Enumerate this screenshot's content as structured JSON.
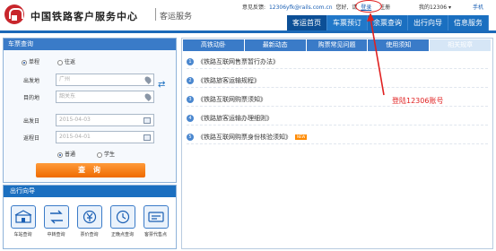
{
  "header": {
    "site_name": "中国铁路客户服务中心",
    "site_sub": "客运服务",
    "feedback_label": "意见反馈:",
    "feedback_email": "12306yfk@rails.com.cn",
    "greeting": "您好,",
    "login_prompt": "请",
    "login_link": "登录",
    "register_link": "注册",
    "my_account": "我的12306 ▾",
    "mobile_link": "手机"
  },
  "mainnav": [
    "客运首页",
    "车票预订",
    "余票查询",
    "出行向导",
    "信息服务"
  ],
  "search": {
    "title": "车票查询",
    "trip_one_way": "单程",
    "trip_round": "往返",
    "from_label": "出发地",
    "from_value": "广州",
    "to_label": "目的地",
    "to_value": "韶关东",
    "depart_label": "出发日",
    "depart_value": "2015-04-03",
    "return_label": "返程日",
    "return_value": "2015-04-01",
    "type_normal": "普通",
    "type_student": "学生",
    "query_button": "查 询"
  },
  "guide": {
    "title": "出行向导",
    "items": [
      {
        "label": "车站查询",
        "icon": "station-icon"
      },
      {
        "label": "中转查询",
        "icon": "transfer-icon"
      },
      {
        "label": "票价查询",
        "icon": "price-icon"
      },
      {
        "label": "正晚点查询",
        "icon": "clock-icon"
      },
      {
        "label": "客票代售点",
        "icon": "agency-icon"
      }
    ]
  },
  "tabs": [
    "高铁动卧",
    "最新动态",
    "购票常见问题",
    "使用须知",
    "相关规章"
  ],
  "notices": [
    {
      "num": "1",
      "text": "《铁路互联网售票暂行办法》",
      "new": ""
    },
    {
      "num": "2",
      "text": "《铁路旅客运输规程》",
      "new": ""
    },
    {
      "num": "3",
      "text": "《铁路互联网购票须知》",
      "new": ""
    },
    {
      "num": "4",
      "text": "《铁路旅客运输办理细则》",
      "new": ""
    },
    {
      "num": "5",
      "text": "《铁路互联网购票身份核验须知》",
      "new": "NEW"
    }
  ],
  "annotation": {
    "text": "登陆12306账号",
    "color": "#e02020"
  },
  "colors": {
    "brand_red": "#c8262c",
    "nav_blue": "#1a6fc0",
    "accent_orange": "#ef6a00"
  }
}
